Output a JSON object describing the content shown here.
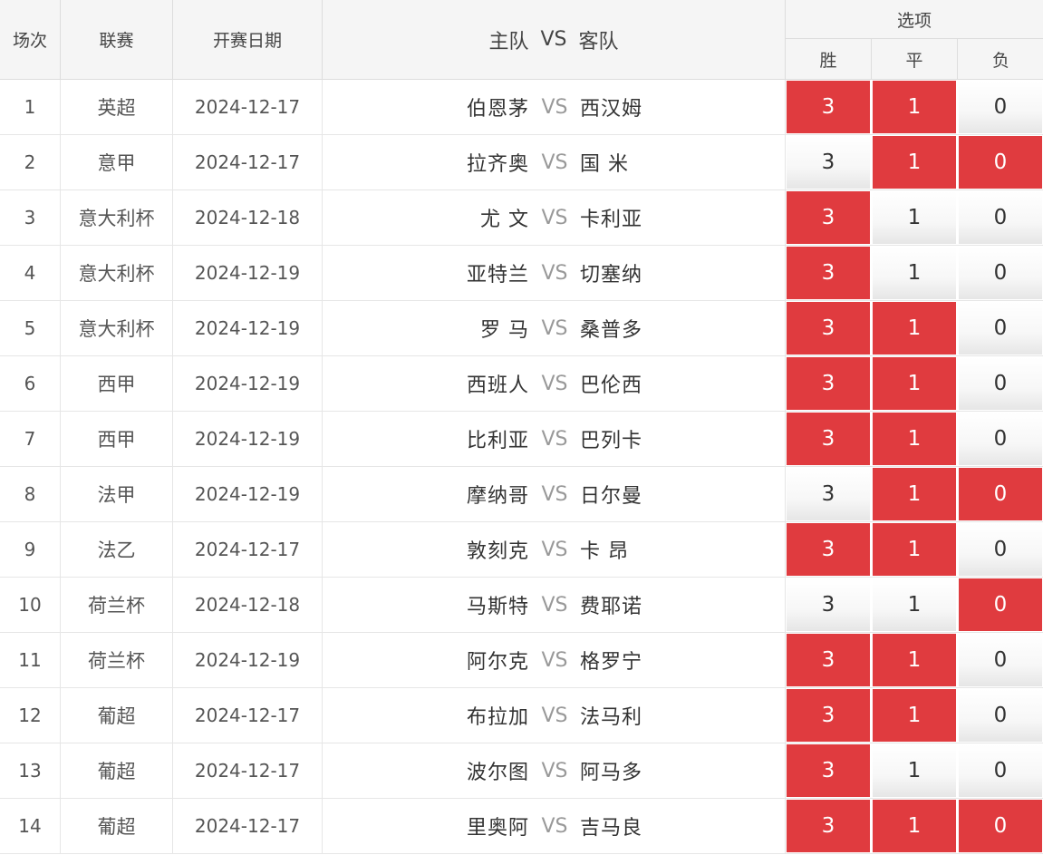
{
  "header": {
    "col_no": "场次",
    "col_league": "联赛",
    "col_date": "开赛日期",
    "col_home": "主队",
    "col_vs": "VS",
    "col_away": "客队",
    "col_options": "选项",
    "opt_win": "胜",
    "opt_draw": "平",
    "opt_lose": "负"
  },
  "colors": {
    "selected": "#e03b3f",
    "unselected": "#f2f2f2",
    "vs": "#999999"
  },
  "rows": [
    {
      "no": "1",
      "league": "英超",
      "date": "2024-12-17",
      "home": "伯恩茅",
      "vs": "VS",
      "away": "西汉姆",
      "options": [
        {
          "label": "3",
          "selected": true
        },
        {
          "label": "1",
          "selected": true
        },
        {
          "label": "0",
          "selected": false
        }
      ]
    },
    {
      "no": "2",
      "league": "意甲",
      "date": "2024-12-17",
      "home": "拉齐奥",
      "vs": "VS",
      "away": "国 米",
      "options": [
        {
          "label": "3",
          "selected": false
        },
        {
          "label": "1",
          "selected": true
        },
        {
          "label": "0",
          "selected": true
        }
      ]
    },
    {
      "no": "3",
      "league": "意大利杯",
      "date": "2024-12-18",
      "home": "尤 文",
      "vs": "VS",
      "away": "卡利亚",
      "options": [
        {
          "label": "3",
          "selected": true
        },
        {
          "label": "1",
          "selected": false
        },
        {
          "label": "0",
          "selected": false
        }
      ]
    },
    {
      "no": "4",
      "league": "意大利杯",
      "date": "2024-12-19",
      "home": "亚特兰",
      "vs": "VS",
      "away": "切塞纳",
      "options": [
        {
          "label": "3",
          "selected": true
        },
        {
          "label": "1",
          "selected": false
        },
        {
          "label": "0",
          "selected": false
        }
      ]
    },
    {
      "no": "5",
      "league": "意大利杯",
      "date": "2024-12-19",
      "home": "罗 马",
      "vs": "VS",
      "away": "桑普多",
      "options": [
        {
          "label": "3",
          "selected": true
        },
        {
          "label": "1",
          "selected": true
        },
        {
          "label": "0",
          "selected": false
        }
      ]
    },
    {
      "no": "6",
      "league": "西甲",
      "date": "2024-12-19",
      "home": "西班人",
      "vs": "VS",
      "away": "巴伦西",
      "options": [
        {
          "label": "3",
          "selected": true
        },
        {
          "label": "1",
          "selected": true
        },
        {
          "label": "0",
          "selected": false
        }
      ]
    },
    {
      "no": "7",
      "league": "西甲",
      "date": "2024-12-19",
      "home": "比利亚",
      "vs": "VS",
      "away": "巴列卡",
      "options": [
        {
          "label": "3",
          "selected": true
        },
        {
          "label": "1",
          "selected": true
        },
        {
          "label": "0",
          "selected": false
        }
      ]
    },
    {
      "no": "8",
      "league": "法甲",
      "date": "2024-12-19",
      "home": "摩纳哥",
      "vs": "VS",
      "away": "日尔曼",
      "options": [
        {
          "label": "3",
          "selected": false
        },
        {
          "label": "1",
          "selected": true
        },
        {
          "label": "0",
          "selected": true
        }
      ]
    },
    {
      "no": "9",
      "league": "法乙",
      "date": "2024-12-17",
      "home": "敦刻克",
      "vs": "VS",
      "away": "卡 昂",
      "options": [
        {
          "label": "3",
          "selected": true
        },
        {
          "label": "1",
          "selected": true
        },
        {
          "label": "0",
          "selected": false
        }
      ]
    },
    {
      "no": "10",
      "league": "荷兰杯",
      "date": "2024-12-18",
      "home": "马斯特",
      "vs": "VS",
      "away": "费耶诺",
      "options": [
        {
          "label": "3",
          "selected": false
        },
        {
          "label": "1",
          "selected": false
        },
        {
          "label": "0",
          "selected": true
        }
      ]
    },
    {
      "no": "11",
      "league": "荷兰杯",
      "date": "2024-12-19",
      "home": "阿尔克",
      "vs": "VS",
      "away": "格罗宁",
      "options": [
        {
          "label": "3",
          "selected": true
        },
        {
          "label": "1",
          "selected": true
        },
        {
          "label": "0",
          "selected": false
        }
      ]
    },
    {
      "no": "12",
      "league": "葡超",
      "date": "2024-12-17",
      "home": "布拉加",
      "vs": "VS",
      "away": "法马利",
      "options": [
        {
          "label": "3",
          "selected": true
        },
        {
          "label": "1",
          "selected": true
        },
        {
          "label": "0",
          "selected": false
        }
      ]
    },
    {
      "no": "13",
      "league": "葡超",
      "date": "2024-12-17",
      "home": "波尔图",
      "vs": "VS",
      "away": "阿马多",
      "options": [
        {
          "label": "3",
          "selected": true
        },
        {
          "label": "1",
          "selected": false
        },
        {
          "label": "0",
          "selected": false
        }
      ]
    },
    {
      "no": "14",
      "league": "葡超",
      "date": "2024-12-17",
      "home": "里奥阿",
      "vs": "VS",
      "away": "吉马良",
      "options": [
        {
          "label": "3",
          "selected": true
        },
        {
          "label": "1",
          "selected": true
        },
        {
          "label": "0",
          "selected": true
        }
      ]
    }
  ]
}
